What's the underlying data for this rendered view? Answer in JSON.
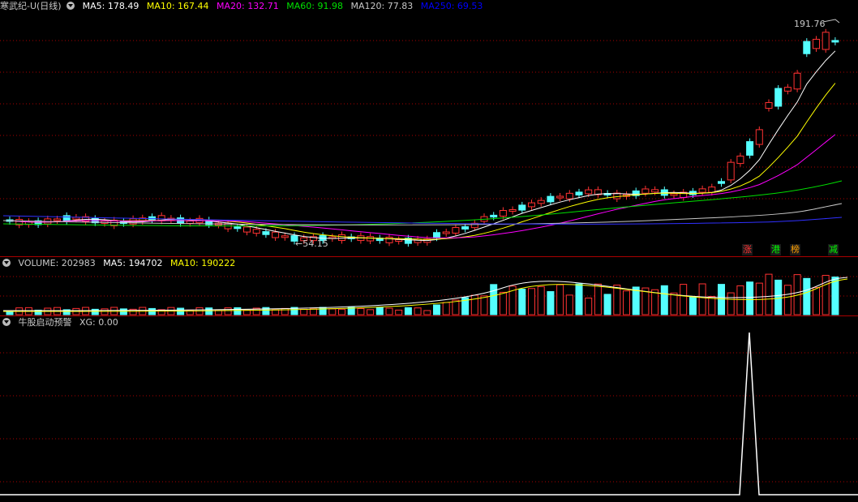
{
  "main": {
    "title": "寒武纪-U(日线)",
    "indicators": [
      {
        "label": "MA5: 178.49",
        "color": "#ffffff"
      },
      {
        "label": "MA10: 167.44",
        "color": "#ffff00"
      },
      {
        "label": "MA20: 132.71",
        "color": "#ff00ff"
      },
      {
        "label": "MA60: 91.98",
        "color": "#00e000"
      },
      {
        "label": "MA120: 77.83",
        "color": "#c8c8c8"
      },
      {
        "label": "MA250: 69.53",
        "color": "#0000ff"
      }
    ],
    "high_label": "191.76",
    "low_label": "54.15",
    "tags": [
      {
        "text": "涨",
        "color": "#ff3030"
      },
      {
        "text": "港",
        "color": "#00ff00"
      },
      {
        "text": "榜",
        "color": "#ffa000"
      },
      {
        "text": "减",
        "color": "#00ff00"
      }
    ]
  },
  "volume": {
    "label": "VOLUME: 202983",
    "ma5": "MA5: 194702",
    "ma10": "MA10: 190222"
  },
  "indicator_pane": {
    "title": "牛股启动预警",
    "xg": "XG: 0.00"
  },
  "colors": {
    "up": "#ff3232",
    "down": "#54ffff",
    "grid": "#aa0000"
  }
}
